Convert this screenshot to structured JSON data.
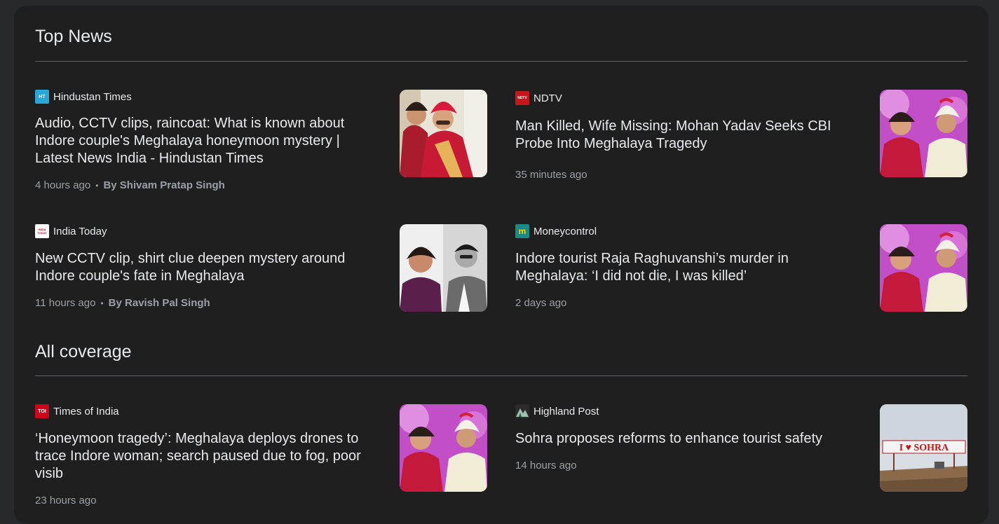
{
  "sections": {
    "top_news": "Top News",
    "all_coverage": "All coverage"
  },
  "articles": [
    {
      "source": "Hindustan Times",
      "logo_text": "HT",
      "headline": "Audio, CCTV clips, raincoat: What is known about Indore couple's Meghalaya honeymoon mystery | Latest News India - Hindustan Times",
      "time": "4 hours ago",
      "author": "By Shivam Pratap Singh"
    },
    {
      "source": "NDTV",
      "logo_text": "NDTV",
      "headline": "Man Killed, Wife Missing: Mohan Yadav Seeks CBI Probe Into Meghalaya Tragedy",
      "time": "35 minutes ago",
      "author": ""
    },
    {
      "source": "India Today",
      "logo_text": "INDIA TODAY",
      "headline": "New CCTV clip, shirt clue deepen mystery around Indore couple's fate in Meghalaya",
      "time": "11 hours ago",
      "author": "By Ravish Pal Singh"
    },
    {
      "source": "Moneycontrol",
      "logo_text": "m",
      "headline": "Indore tourist Raja Raghuvanshi’s murder in Meghalaya: ‘I did not die, I was killed’",
      "time": "2 days ago",
      "author": ""
    },
    {
      "source": "Times of India",
      "logo_text": "TOI",
      "headline": "‘Honeymoon tragedy’: Meghalaya deploys drones to trace Indore woman; search paused due to fog, poor visib",
      "time": "23 hours ago",
      "author": ""
    },
    {
      "source": "Highland Post",
      "logo_text": "",
      "headline": "Sohra proposes reforms to enhance tourist safety",
      "time": "14 hours ago",
      "author": ""
    }
  ],
  "sign_text": "I ♥ SOHRA",
  "colors": {
    "background": "#1f1f1f",
    "text_primary": "#e8eaed",
    "text_secondary": "#9aa0a6",
    "divider": "#5f6368"
  }
}
